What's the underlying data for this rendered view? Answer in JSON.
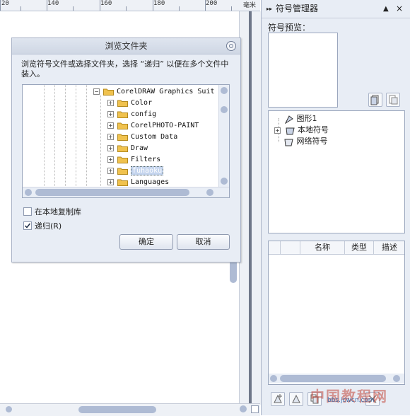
{
  "ruler": {
    "labels": [
      "20",
      "140",
      "160",
      "180",
      "200"
    ],
    "unit": "毫米"
  },
  "dialog": {
    "title": "浏览文件夹",
    "description": "浏览符号文件或选择文件夹，选择 “递归” 以便在多个文件中装入。",
    "tree_items": [
      {
        "label": "CorelDRAW Graphics Suit",
        "expander": "−"
      },
      {
        "label": "Color",
        "expander": "+"
      },
      {
        "label": "config",
        "expander": "+"
      },
      {
        "label": "CorelPHOTO-PAINT",
        "expander": "+"
      },
      {
        "label": "Custom Data",
        "expander": "+"
      },
      {
        "label": "Draw",
        "expander": "+"
      },
      {
        "label": "Filters",
        "expander": "+"
      },
      {
        "label": "fuhaoku",
        "expander": "+",
        "selected": true
      },
      {
        "label": "Languages",
        "expander": "+"
      }
    ],
    "option_local_copy": "在本地复制库",
    "option_recursive": "递归(R)",
    "recursive_checked": true,
    "local_copy_checked": false,
    "ok_label": "确定",
    "cancel_label": "取消"
  },
  "docker": {
    "title": "符号管理器",
    "preview_label": "符号预览：",
    "tree_items": [
      {
        "label": "图形1",
        "expander": ""
      },
      {
        "label": "本地符号",
        "expander": "+"
      },
      {
        "label": "网络符号",
        "expander": ""
      }
    ],
    "list_columns": [
      "名称",
      "类型",
      "描述"
    ]
  },
  "watermark": {
    "line1": "中国教程网",
    "line2": "bbs.jcwcn.com"
  },
  "colors": {
    "folder": "#f0c24e",
    "chrome": "#e8edf5",
    "scroll_thumb": "#aebbd4",
    "selection": "#c5d5ee"
  },
  "icons": [
    "close-icon",
    "folder-icon",
    "expand-icon",
    "collapse-icon",
    "check-icon",
    "symbol-icon",
    "library-icon"
  ]
}
